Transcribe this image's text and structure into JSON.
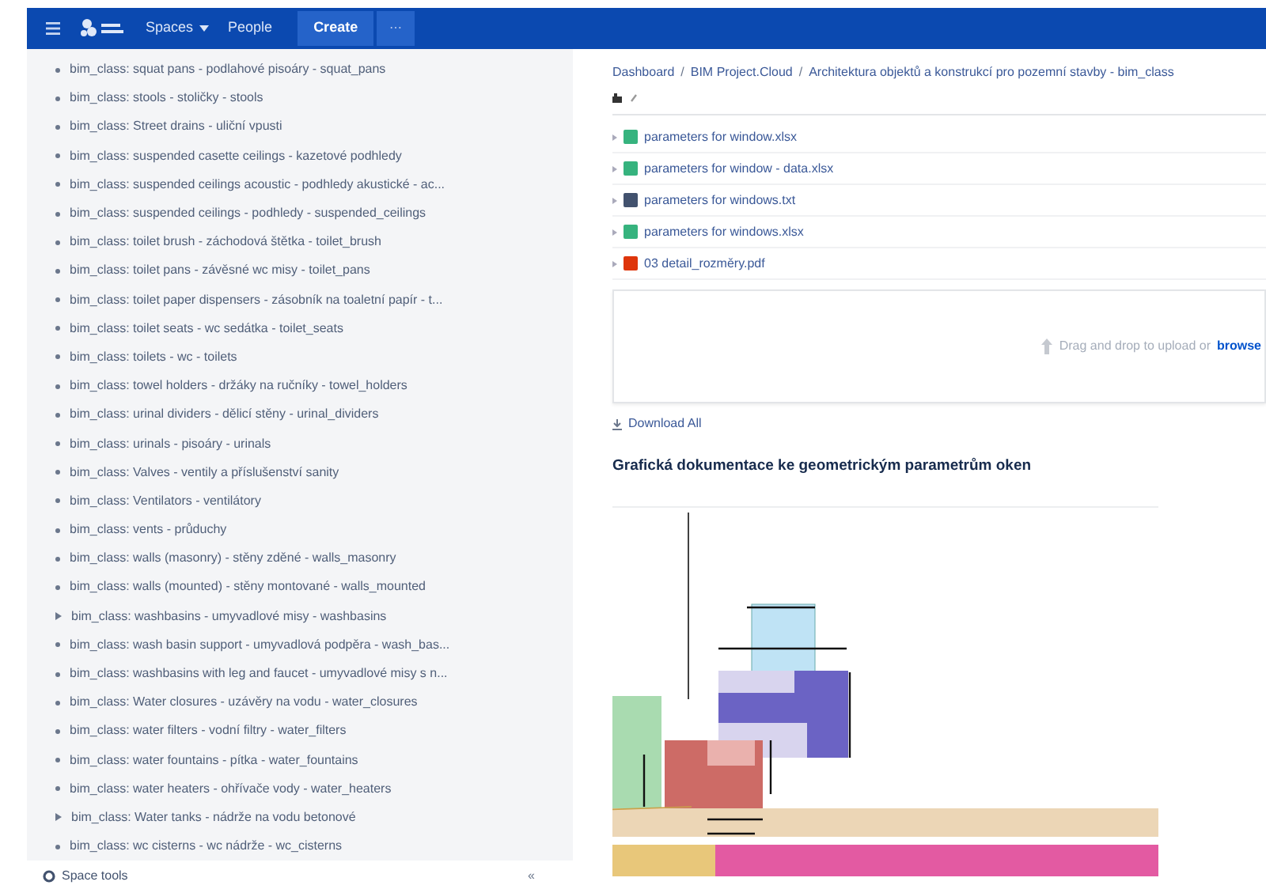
{
  "nav": {
    "items": [
      {
        "label": "Spaces",
        "dropdown": true
      },
      {
        "label": "People",
        "dropdown": false
      }
    ],
    "create": "Create",
    "more": "⋯"
  },
  "sidebar": {
    "items": [
      {
        "kind": "leaf",
        "text": "bim_class: squat pans - podlahové pisoáry - squat_pans"
      },
      {
        "kind": "leaf",
        "text": "bim_class: stools - stoličky - stools"
      },
      {
        "kind": "leaf",
        "text": "bim_class: Street drains - uliční vpusti"
      },
      {
        "kind": "leaf",
        "text": "bim_class: suspended casette ceilings - kazetové podhledy"
      },
      {
        "kind": "leaf",
        "text": "bim_class: suspended ceilings acoustic - podhledy akustické - ac..."
      },
      {
        "kind": "leaf",
        "text": "bim_class: suspended ceilings - podhledy - suspended_ceilings"
      },
      {
        "kind": "leaf",
        "text": "bim_class: toilet brush - záchodová štětka - toilet_brush"
      },
      {
        "kind": "leaf",
        "text": "bim_class: toilet pans - závěsné wc misy - toilet_pans"
      },
      {
        "kind": "leaf",
        "text": "bim_class: toilet paper dispensers - zásobník na toaletní papír - t..."
      },
      {
        "kind": "leaf",
        "text": "bim_class: toilet seats - wc sedátka - toilet_seats"
      },
      {
        "kind": "leaf",
        "text": "bim_class: toilets - wc - toilets"
      },
      {
        "kind": "leaf",
        "text": "bim_class: towel holders - držáky na ručníky - towel_holders"
      },
      {
        "kind": "leaf",
        "text": "bim_class: urinal dividers - dělicí stěny - urinal_dividers"
      },
      {
        "kind": "leaf",
        "text": "bim_class: urinals - pisoáry - urinals"
      },
      {
        "kind": "leaf",
        "text": "bim_class: Valves - ventily a příslušenství sanity"
      },
      {
        "kind": "leaf",
        "text": "bim_class: Ventilators - ventilátory"
      },
      {
        "kind": "leaf",
        "text": "bim_class: vents - průduchy"
      },
      {
        "kind": "leaf",
        "text": "bim_class: walls (masonry) - stěny zděné - walls_masonry"
      },
      {
        "kind": "leaf",
        "text": "bim_class: walls (mounted) - stěny montované - walls_mounted"
      },
      {
        "kind": "collapsed",
        "text": "bim_class: washbasins - umyvadlové misy - washbasins"
      },
      {
        "kind": "leaf",
        "text": "bim_class: wash basin support - umyvadlová podpěra - wash_bas..."
      },
      {
        "kind": "leaf",
        "text": "bim_class: washbasins with leg and faucet - umyvadlové misy s n..."
      },
      {
        "kind": "leaf",
        "text": "bim_class: Water closures - uzávěry na vodu - water_closures"
      },
      {
        "kind": "leaf",
        "text": "bim_class: water filters - vodní filtry - water_filters"
      },
      {
        "kind": "leaf",
        "text": "bim_class: water fountains - pítka - water_fountains"
      },
      {
        "kind": "leaf",
        "text": "bim_class: water heaters - ohřívače vody - water_heaters"
      },
      {
        "kind": "collapsed",
        "text": "bim_class: Water tanks - nádrže na vodu betonové"
      },
      {
        "kind": "leaf",
        "text": "bim_class: wc cisterns - wc nádrže - wc_cisterns"
      }
    ],
    "footer": "Space tools",
    "collapse": "«"
  },
  "breadcrumb_separator": "/",
  "breadcrumb": [
    "Dashboard",
    "BIM Project.Cloud",
    "Architektura objektů a konstrukcí pro pozemní stavby - bim_class"
  ],
  "files": [
    {
      "kind": "xlsx",
      "name": "parameters for window.xlsx"
    },
    {
      "kind": "xlsx",
      "name": "parameters for window - data.xlsx"
    },
    {
      "kind": "txt",
      "name": "parameters for windows.txt"
    },
    {
      "kind": "xlsx",
      "name": "parameters for windows.xlsx"
    },
    {
      "kind": "pdf",
      "name": "03 detail_rozměry.pdf"
    }
  ],
  "dropzone": {
    "text": "Drag and drop to upload or",
    "link": "browse"
  },
  "download_all": "Download All",
  "heading": "Grafická dokumentace ke geometrickým parametrům oken"
}
